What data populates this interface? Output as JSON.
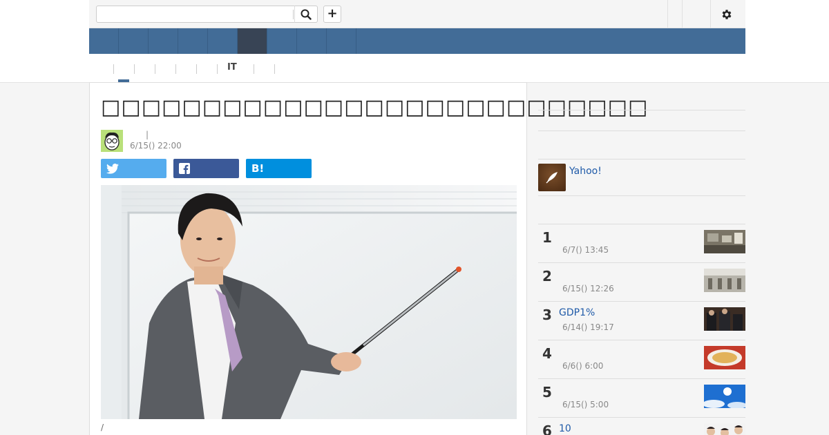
{
  "article": {
    "title": "□□□□□□□□□□□□□□□□□□□□□□□□□□□",
    "byline_separator": "|",
    "date": "6/15() 22:00",
    "photo_caption": "/"
  },
  "subnav": {
    "it_label": "IT"
  },
  "sidebar": {
    "yahoo_label": "Yahoo!",
    "ranking": [
      {
        "rank": "1",
        "title": "",
        "date": "6/7() 13:45"
      },
      {
        "rank": "2",
        "title": "",
        "date": "6/15() 12:26"
      },
      {
        "rank": "3",
        "title": "GDP1%",
        "date": "6/14() 19:17"
      },
      {
        "rank": "4",
        "title": "",
        "date": "6/6() 6:00"
      },
      {
        "rank": "5",
        "title": "",
        "date": "6/15() 5:00"
      },
      {
        "rank": "6",
        "title": "10",
        "date": ""
      }
    ]
  },
  "share": {
    "twitter_icon": "twitter-bird",
    "facebook_icon": "facebook-f",
    "hatena_label": "B!"
  },
  "colors": {
    "nav_blue": "#426c97",
    "nav_active": "#384455",
    "twitter": "#55acee",
    "facebook": "#3b5998",
    "hatena": "#008fde",
    "link": "#1f5aa8"
  }
}
